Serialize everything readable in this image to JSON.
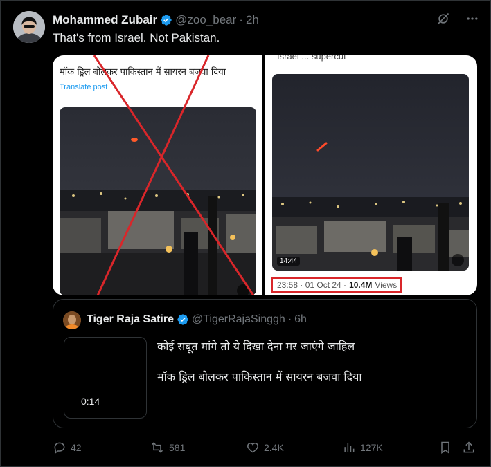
{
  "post": {
    "author_name": "Mohammed Zubair",
    "handle": "@zoo_bear",
    "separator": "·",
    "time": "2h",
    "text": "That's from Israel. Not Pakistan."
  },
  "media": {
    "left_caption": "मॉक ड्रिल बोलकर पाकिस्तान में सायरन बजवा दिया",
    "left_translate": "Translate post",
    "right_caption": "Israel ... supercut",
    "right_duration": "14:44",
    "timestamp": "23:58 · 01 Oct 24 · ",
    "views_count": "10.4M",
    "views_label": "Views",
    "annotation_color": "#d9262a"
  },
  "quote": {
    "author_name": "Tiger Raja Satire",
    "handle": "@TigerRajaSinggh",
    "separator": "·",
    "time": "6h",
    "video_duration": "0:14",
    "line1": "कोई सबूत मांगे तो ये दिखा देना मर जाएंगे जाहिल",
    "line2": "मॉक ड्रिल बोलकर पाकिस्तान में सायरन बजवा दिया"
  },
  "actions": {
    "replies": "42",
    "reposts": "581",
    "likes": "2.4K",
    "views": "127K"
  },
  "icons": {
    "verified": "verified-badge-icon",
    "grok": "grok-icon",
    "more": "more-icon",
    "reply": "reply-icon",
    "repost": "repost-icon",
    "like": "like-icon",
    "views": "views-icon",
    "bookmark": "bookmark-icon",
    "share": "share-icon"
  },
  "colors": {
    "background": "#000000",
    "text": "#e7e9ea",
    "muted": "#71767b",
    "accent": "#1d9bf0",
    "border": "#2f3336"
  }
}
